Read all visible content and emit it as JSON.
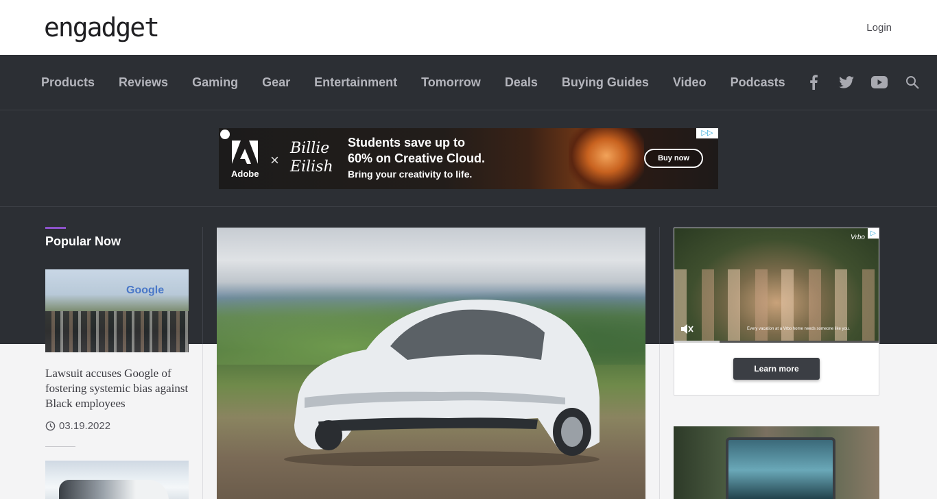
{
  "header": {
    "logo": "engadget",
    "login_label": "Login"
  },
  "nav": {
    "items": [
      "Products",
      "Reviews",
      "Gaming",
      "Gear",
      "Entertainment",
      "Tomorrow",
      "Deals",
      "Buying Guides",
      "Video",
      "Podcasts"
    ],
    "icons": [
      "facebook-icon",
      "twitter-icon",
      "youtube-icon",
      "search-icon"
    ]
  },
  "banner_ad": {
    "brand": "Adobe",
    "collab_line1": "Billie",
    "collab_line2": "Eilish",
    "separator": "×",
    "headline_line1": "Students save up to",
    "headline_line2": "60% on Creative Cloud.",
    "subline": "Bring your creativity to life.",
    "cta": "Buy now",
    "adchoices": "▷▷"
  },
  "popular": {
    "title": "Popular Now",
    "items": [
      {
        "headline": "Lawsuit accuses Google of fostering systemic bias against Black employees",
        "date": "03.19.2022",
        "thumb_sign": "Google"
      }
    ]
  },
  "side_ad": {
    "brand": "Vrbo",
    "caption": "Every vacation at a Vrbo home needs someone like you.",
    "cta": "Learn more",
    "adchoices": "▷",
    "video_progress": 0.22
  },
  "colors": {
    "dark_bg": "#2c2f34",
    "accent_bar": "#8c52c9",
    "nav_text": "#b4b5bc"
  }
}
